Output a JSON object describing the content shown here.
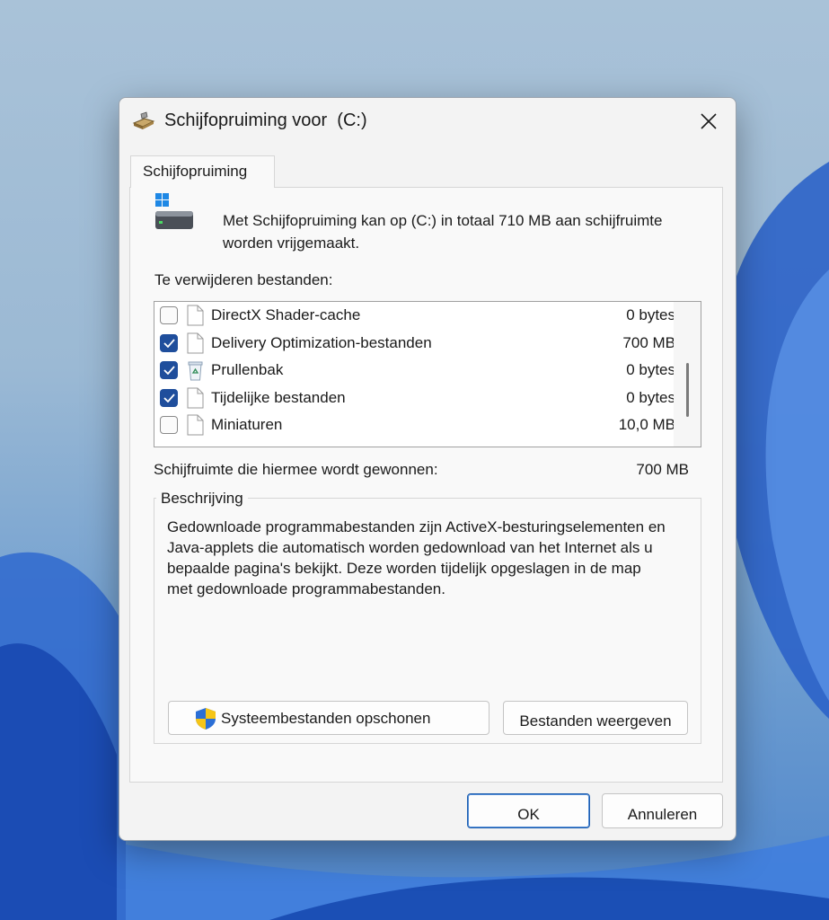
{
  "window": {
    "title": "Schijfopruiming voor  (C:)",
    "icons": {
      "app": "disk-cleanup-icon",
      "close": "close-icon"
    }
  },
  "tab": {
    "label": "Schijfopruiming"
  },
  "intro": {
    "text": "Met Schijfopruiming kan op  (C:) in totaal 710 MB aan schijfruimte worden vrijgemaakt.",
    "icon": "drive-icon"
  },
  "files": {
    "label": "Te verwijderen bestanden:",
    "items": [
      {
        "label": "DirectX Shader-cache",
        "size": "0 bytes",
        "checked": false,
        "icon": "file-icon"
      },
      {
        "label": "Delivery Optimization-bestanden",
        "size": "700 MB",
        "checked": true,
        "icon": "file-icon"
      },
      {
        "label": "Prullenbak",
        "size": "0 bytes",
        "checked": true,
        "icon": "recycle-bin-icon"
      },
      {
        "label": "Tijdelijke bestanden",
        "size": "0 bytes",
        "checked": true,
        "icon": "file-icon"
      },
      {
        "label": "Miniaturen",
        "size": "10,0 MB",
        "checked": false,
        "icon": "file-icon"
      }
    ]
  },
  "gain": {
    "label": "Schijfruimte die hiermee wordt gewonnen:",
    "value": "700 MB"
  },
  "description": {
    "legend": "Beschrijving",
    "text": "Gedownloade programmabestanden zijn ActiveX-besturingselementen en Java-applets die automatisch worden gedownload van het Internet als u bepaalde pagina's bekijkt. Deze worden tijdelijk opgeslagen in de map met gedownloade programmabestanden."
  },
  "buttons": {
    "system_cleanup": "Systeembestanden opschonen",
    "view_files": "Bestanden weergeven",
    "ok": "OK",
    "cancel": "Annuleren"
  },
  "colors": {
    "accent": "#1f4e9c",
    "dialog_bg": "#f3f3f3"
  }
}
